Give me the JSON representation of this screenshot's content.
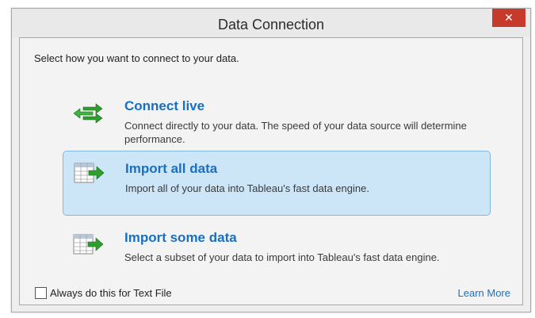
{
  "dialog": {
    "title": "Data Connection",
    "close_glyph": "✕"
  },
  "prompt": "Select how you want to connect to your data.",
  "options": [
    {
      "title": "Connect live",
      "description": "Connect directly to your data. The speed of your data source will determine performance.",
      "icon": "connect-live-arrows-icon",
      "selected": false
    },
    {
      "title": "Import all data",
      "description": "Import all of your data into Tableau's fast data engine.",
      "icon": "import-table-icon",
      "selected": true
    },
    {
      "title": "Import some data",
      "description": "Select a subset of your data to import into Tableau's fast data engine.",
      "icon": "import-table-icon",
      "selected": false
    }
  ],
  "footer": {
    "checkbox_label": "Always do this for Text File",
    "checkbox_checked": false,
    "learn_more": "Learn More"
  },
  "colors": {
    "accent": "#1a6fc0",
    "close_button": "#c7392b",
    "selected_fill": "#cde6f7",
    "selected_border": "#7fb8e2",
    "arrow_green": "#2e9e2e"
  }
}
